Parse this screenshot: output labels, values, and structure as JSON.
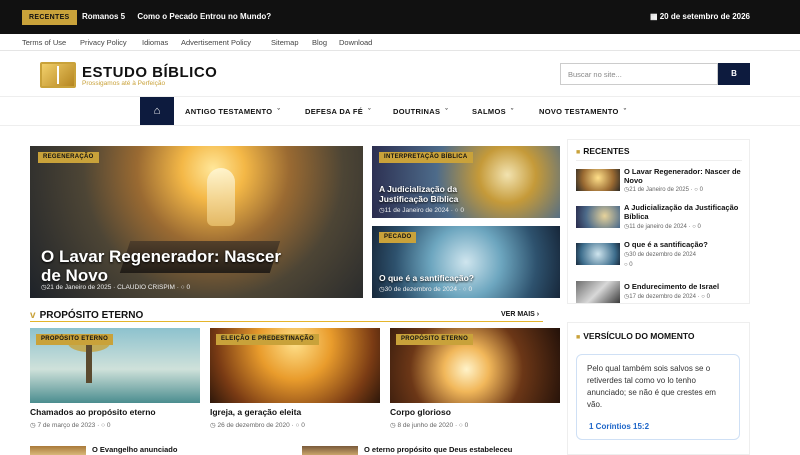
{
  "topbar": {
    "badge": "RECENTES",
    "ticker": [
      "Romanos 5",
      "Como o Pecado Entrou no Mundo?"
    ],
    "date": "20 de setembro de 2026"
  },
  "links": [
    "Terms of Use",
    "Privacy Policy",
    "Idiomas",
    "Advertisement Policy",
    "Sitemap",
    "Blog",
    "Download"
  ],
  "brand": {
    "name": "ESTUDO BÍBLICO",
    "tagline": "Prossigamos até à Perfeição"
  },
  "search": {
    "placeholder": "Buscar no site...",
    "button": "B"
  },
  "nav": {
    "home_icon": "home-icon",
    "items": [
      "ANTIGO TESTAMENTO",
      "DEFESA DA FÉ",
      "DOUTRINAS",
      "SALMOS",
      "NOVO TESTAMENTO"
    ]
  },
  "hero": {
    "category": "REGENERAÇÃO",
    "title": "O Lavar Regenerador: Nascer de Novo",
    "meta": "21 de Janeiro de 2025",
    "author": "CLAUDIO CRISPIM",
    "comments": "0"
  },
  "cards": [
    {
      "category": "INTERPRETAÇÃO BÍBLICA",
      "title": "A Judicialização da Justificação Bíblica",
      "meta": "11 de Janeiro de 2024",
      "comments": "0"
    },
    {
      "category": "PECADO",
      "title": "O que é a santificação?",
      "meta": "30 de dezembro de 2024",
      "comments": "0"
    }
  ],
  "section": {
    "title": "PROPÓSITO ETERNO",
    "more": "VER MAIS"
  },
  "grid": [
    {
      "category": "PROPÓSITO ETERNO",
      "title": "Chamados ao propósito eterno",
      "meta": "7 de março de 2023",
      "comments": "0"
    },
    {
      "category": "ELEIÇÃO E PREDESTINAÇÃO",
      "title": "Igreja, a geração eleita",
      "meta": "26 de dezembro de 2020",
      "comments": "0"
    },
    {
      "category": "PROPÓSITO ETERNO",
      "title": "Corpo glorioso",
      "meta": "8 de junho de 2020",
      "comments": "0"
    }
  ],
  "bottom": [
    "O Evangelho anunciado",
    "O eterno propósito que Deus estabeleceu"
  ],
  "sidebar": {
    "recent_title": "RECENTES",
    "recent": [
      {
        "title": "O Lavar Regenerador: Nascer de Novo",
        "meta": "21 de Janeiro de 2025",
        "comments": "0"
      },
      {
        "title": "A Judicialização da Justificação Bíblica",
        "meta": "11 de janeiro de 2024",
        "comments": "0"
      },
      {
        "title": "O que é a santificação?",
        "meta": "30 de dezembro de 2024",
        "comments": "0"
      },
      {
        "title": "O Endurecimento de Israel",
        "meta": "17 de dezembro de 2024",
        "comments": "0"
      }
    ],
    "verse_title": "VERSÍCULO DO MOMENTO",
    "verse_text": "Pelo qual também sois salvos se o retiverdes tal como vo lo tenho anunciado; se não é que crestes em vão.",
    "verse_ref": "1 Coríntios 15:2"
  }
}
